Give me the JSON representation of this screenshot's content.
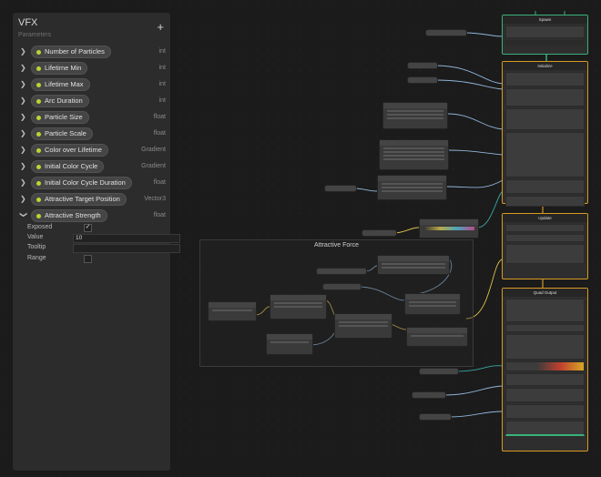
{
  "blackboard": {
    "title": "VFX",
    "subtitle": "Parameters",
    "add_label": "+",
    "properties": [
      {
        "name": "Number of Particles",
        "type": "int",
        "expanded": false
      },
      {
        "name": "Lifetime Min",
        "type": "int",
        "expanded": false
      },
      {
        "name": "Lifetime Max",
        "type": "int",
        "expanded": false
      },
      {
        "name": "Arc Duration",
        "type": "int",
        "expanded": false
      },
      {
        "name": "Particle Size",
        "type": "float",
        "expanded": false
      },
      {
        "name": "Particle Scale",
        "type": "float",
        "expanded": false
      },
      {
        "name": "Color over Lifetime",
        "type": "Gradient",
        "expanded": false
      },
      {
        "name": "Initial Color Cycle",
        "type": "Gradient",
        "expanded": false
      },
      {
        "name": "Initial Color Cycle Duration",
        "type": "float",
        "expanded": false
      },
      {
        "name": "Attractive Target Position",
        "type": "Vector3",
        "expanded": false
      },
      {
        "name": "Attractive Strength",
        "type": "float",
        "expanded": true
      }
    ],
    "expanded_fields": {
      "exposed_label": "Exposed",
      "exposed_value": "✓",
      "value_label": "Value",
      "value": "10",
      "tooltip_label": "Tooltip",
      "tooltip_value": "",
      "range_label": "Range"
    },
    "icons": {
      "expanded": "chevron-down-icon",
      "collapsed": "chevron-right-icon",
      "exposed_dot": "exposed-dot-icon"
    },
    "dot_color": "#bcd534"
  },
  "graph": {
    "group_title": "Attractive Force",
    "contexts": {
      "spawn": "Spawn",
      "initialize": "Initialize",
      "update": "Update",
      "output": "Quad Output"
    },
    "accent_colors": {
      "flow": "#d79a23",
      "spawn_border": "#39b27b",
      "wire_float": "#8fb4d9",
      "wire_color": "#3ba6a0",
      "wire_vector": "#e0c14b"
    }
  }
}
